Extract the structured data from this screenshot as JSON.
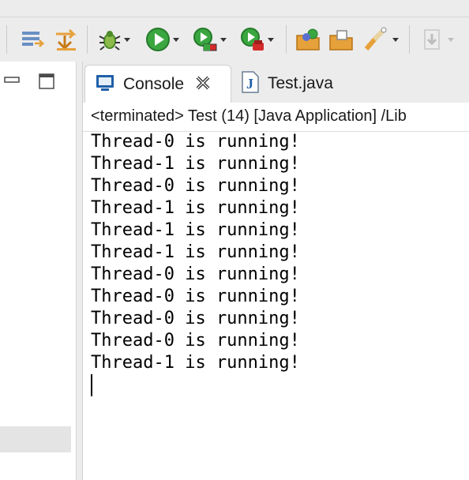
{
  "toolbar": {
    "items": [
      {
        "name": "toggle-breakpoints-icon"
      },
      {
        "name": "step-filters-icon"
      },
      {
        "name": "debug-icon"
      },
      {
        "name": "run-icon"
      },
      {
        "name": "coverage-icon"
      },
      {
        "name": "external-tools-icon"
      },
      {
        "name": "open-type-icon"
      },
      {
        "name": "open-task-icon"
      },
      {
        "name": "search-icon"
      },
      {
        "name": "next-annotation-icon"
      }
    ]
  },
  "console": {
    "tabs": [
      {
        "label": "Console",
        "icon": "console-icon",
        "active": true
      },
      {
        "label": "Test.java",
        "icon": "java-file-icon",
        "active": false
      }
    ],
    "description": "<terminated> Test (14) [Java Application] /Lib",
    "lines": [
      "Thread-0 is running!",
      "Thread-1 is running!",
      "Thread-0 is running!",
      "Thread-1 is running!",
      "Thread-1 is running!",
      "Thread-1 is running!",
      "Thread-0 is running!",
      "Thread-0 is running!",
      "Thread-0 is running!",
      "Thread-0 is running!",
      "Thread-1 is running!"
    ]
  },
  "colors": {
    "run_green": "#3aa640",
    "debug_green": "#4d8c2a",
    "java_blue": "#1f5fa8",
    "folder_orange": "#e6a13a"
  }
}
